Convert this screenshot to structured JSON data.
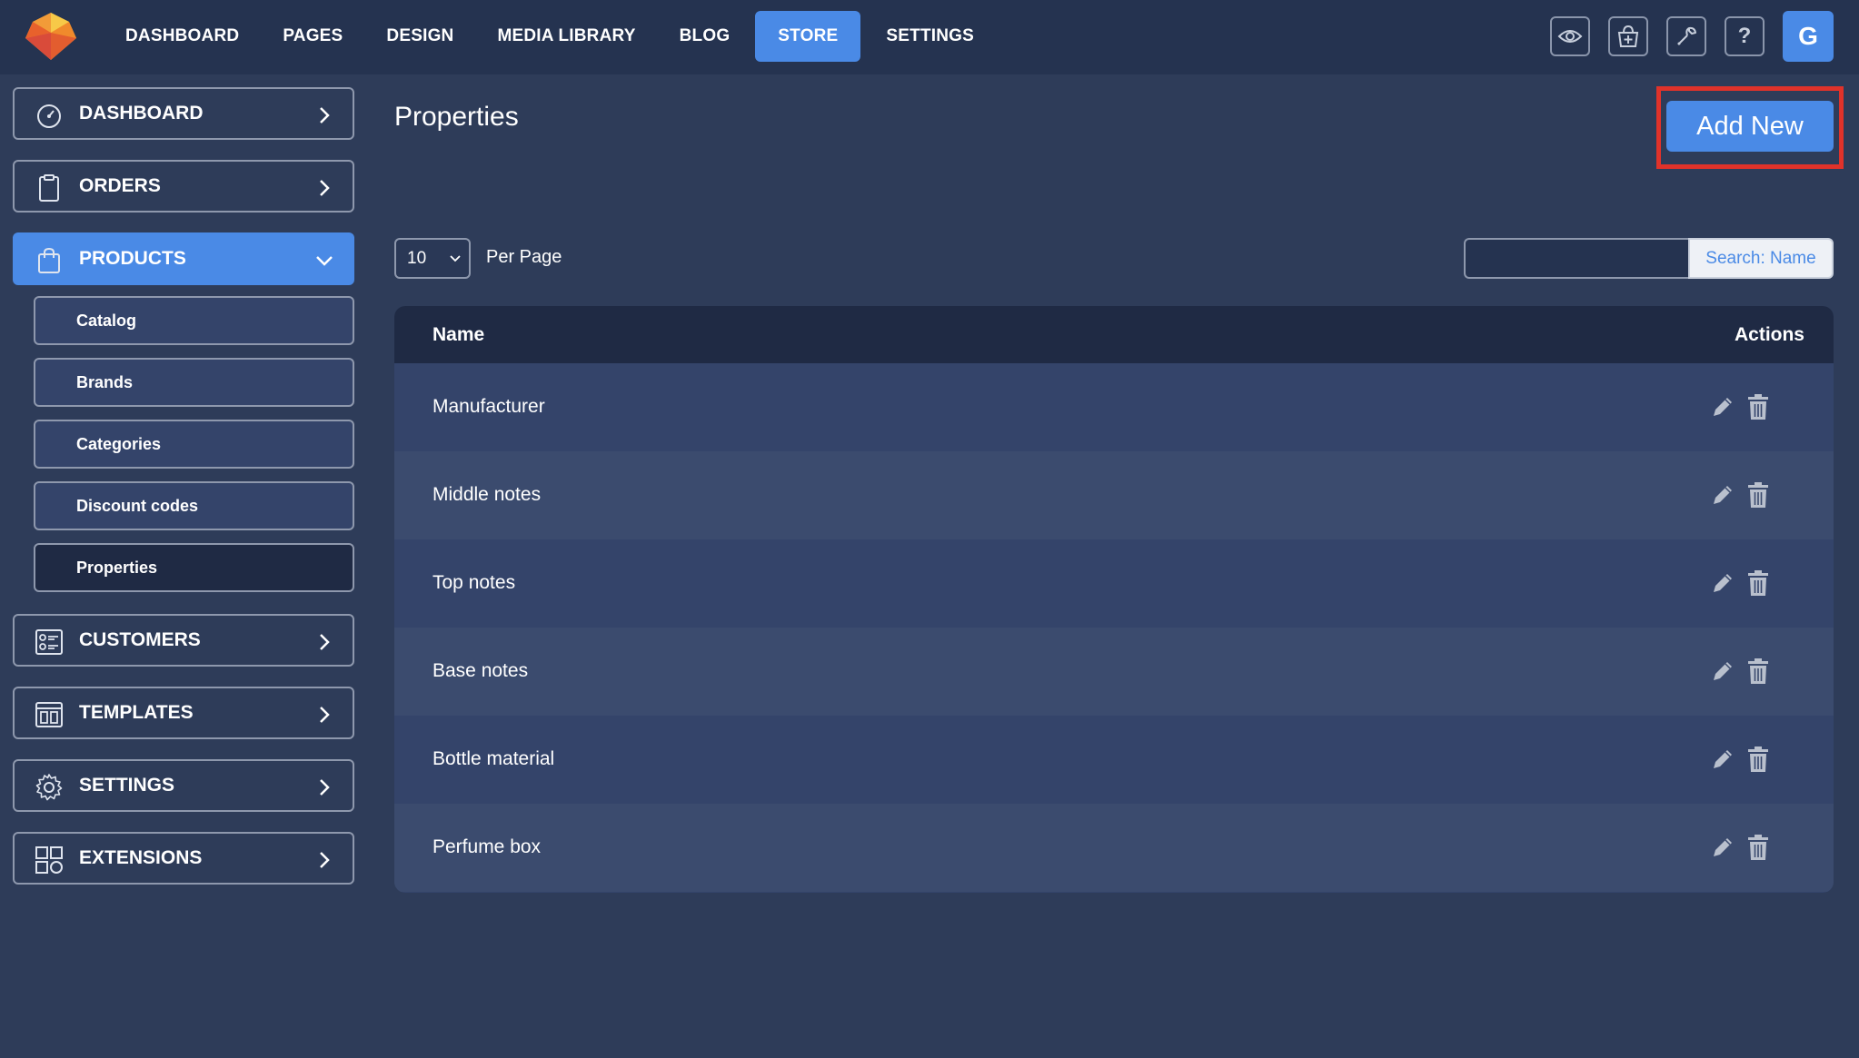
{
  "nav": {
    "items": [
      "DASHBOARD",
      "PAGES",
      "DESIGN",
      "MEDIA LIBRARY",
      "BLOG",
      "STORE",
      "SETTINGS"
    ],
    "active": "STORE",
    "avatar_initial": "G",
    "help_glyph": "?"
  },
  "sidebar": {
    "items": [
      {
        "label": "DASHBOARD",
        "icon": "speedometer-icon"
      },
      {
        "label": "ORDERS",
        "icon": "clipboard-icon"
      },
      {
        "label": "PRODUCTS",
        "icon": "shopping-bag-icon",
        "active": true
      },
      {
        "label": "CUSTOMERS",
        "icon": "address-card-icon"
      },
      {
        "label": "TEMPLATES",
        "icon": "template-icon"
      },
      {
        "label": "SETTINGS",
        "icon": "gear-icon"
      },
      {
        "label": "EXTENSIONS",
        "icon": "extensions-grid-icon"
      }
    ],
    "sub_items": [
      "Catalog",
      "Brands",
      "Categories",
      "Discount codes",
      "Properties"
    ],
    "current_sub": "Properties"
  },
  "main": {
    "title": "Properties",
    "add_new_label": "Add New",
    "per_page_value": "10",
    "per_page_label": "Per Page",
    "search_placeholder": "",
    "search_button": "Search: Name",
    "table": {
      "columns": [
        "Name",
        "Actions"
      ],
      "rows": [
        "Manufacturer",
        "Middle notes",
        "Top notes",
        "Base notes",
        "Bottle material",
        "Perfume box"
      ]
    }
  },
  "colors": {
    "background": "#2e3c59",
    "topbar": "#253350",
    "accent": "#4a8ae6",
    "highlight_frame": "#e0322a"
  }
}
